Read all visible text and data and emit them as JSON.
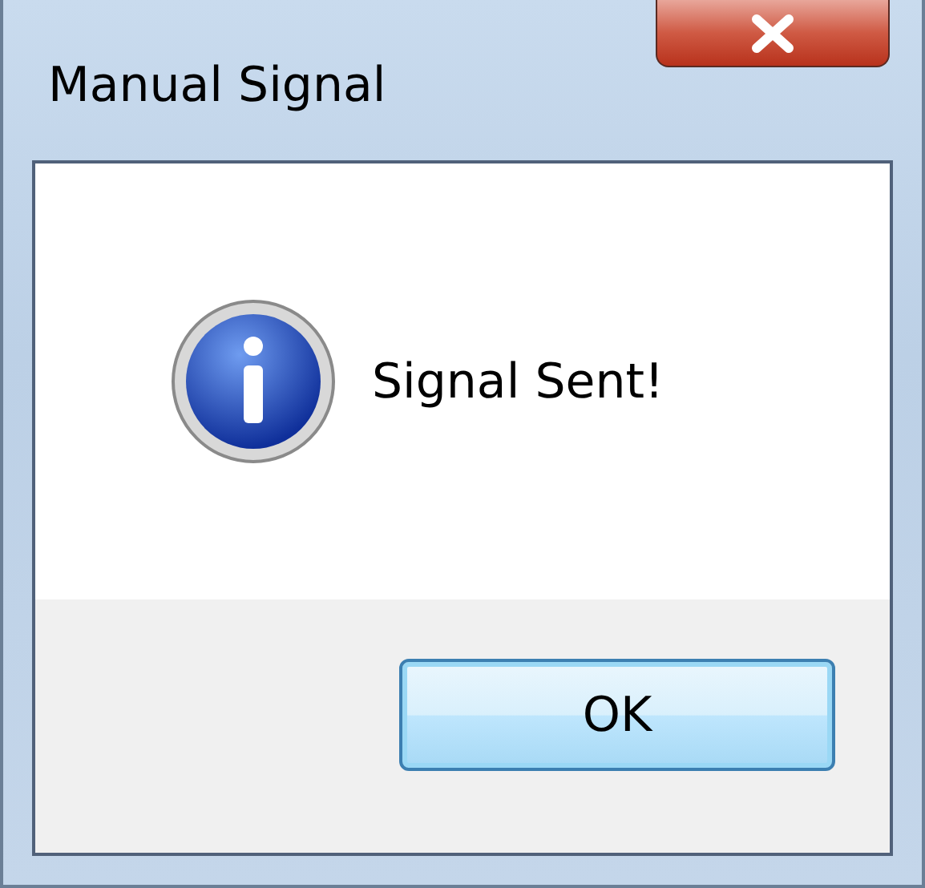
{
  "window": {
    "title": "Manual Signal"
  },
  "message": {
    "kind": "information",
    "text": "Signal Sent!"
  },
  "buttons": [
    {
      "label": "OK",
      "kind": "default"
    }
  ]
}
